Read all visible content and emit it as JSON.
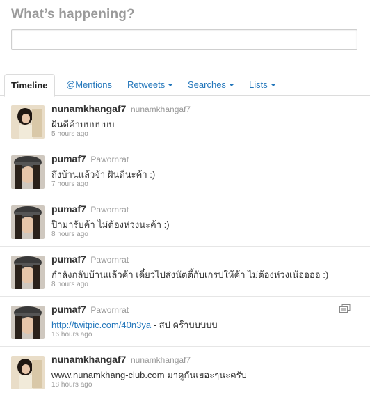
{
  "composer": {
    "title": "What’s happening?",
    "status_value": "",
    "status_placeholder": ""
  },
  "tabs": [
    {
      "label": "Timeline",
      "active": true
    },
    {
      "label": "@Mentions"
    },
    {
      "label": "Retweets"
    },
    {
      "label": "Searches"
    },
    {
      "label": "Lists"
    }
  ],
  "tweets": [
    {
      "screen_name": "nunamkhangaf7",
      "full_name": "nunamkhangaf7",
      "text": "ฝันดีค้าบบบบบบ",
      "time": "5 hours ago"
    },
    {
      "screen_name": "pumaf7",
      "full_name": "Pawornrat",
      "text": "ถึงบ้านแล้วจ้า ฝันดีนะค้า :)",
      "time": "7 hours ago"
    },
    {
      "screen_name": "pumaf7",
      "full_name": "Pawornrat",
      "text": "ป๊ามารับค้า ไม่ต้องห่วงนะค้า :)",
      "time": "8 hours ago"
    },
    {
      "screen_name": "pumaf7",
      "full_name": "Pawornrat",
      "text": "กำลังกลับบ้านแล้วค้า เดี๋ยวไปส่งนัตตี้กับเกรปให้ค้า ไม่ต้องห่วงเน้ออออ :)",
      "time": "8 hours ago"
    },
    {
      "screen_name": "pumaf7",
      "full_name": "Pawornrat",
      "link": "http://twitpic.com/40n3ya",
      "text_after_link": " - สป คร๊าบบบบบ",
      "time": "16 hours ago",
      "media_icon": "media-gallery-icon"
    },
    {
      "screen_name": "nunamkhangaf7",
      "full_name": "nunamkhangaf7",
      "text": "www.nunamkhang-club.com มาดูกันเยอะๆนะครับ",
      "time": "18 hours ago"
    }
  ],
  "colors": {
    "link": "#2276bb",
    "muted": "#999999",
    "title": "#9a9a9a",
    "border": "#dcdcdc"
  }
}
